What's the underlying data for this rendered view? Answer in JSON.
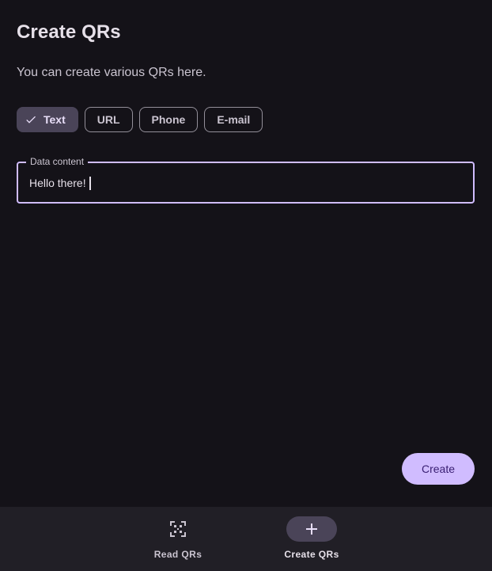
{
  "header": {
    "title": "Create QRs",
    "subtitle": "You can create various QRs here."
  },
  "type_chips": [
    {
      "label": "Text",
      "selected": true
    },
    {
      "label": "URL",
      "selected": false
    },
    {
      "label": "Phone",
      "selected": false
    },
    {
      "label": "E-mail",
      "selected": false
    }
  ],
  "data_field": {
    "label": "Data content",
    "value": "Hello there!"
  },
  "create_button": {
    "label": "Create"
  },
  "bottom_nav": {
    "items": [
      {
        "label": "Read QRs",
        "icon": "qr-scan-icon",
        "active": false
      },
      {
        "label": "Create QRs",
        "icon": "plus-icon",
        "active": true
      }
    ]
  },
  "colors": {
    "background": "#141218",
    "accent": "#d0bcff",
    "chip_selected": "#4a4458",
    "navbar": "#211f26"
  }
}
